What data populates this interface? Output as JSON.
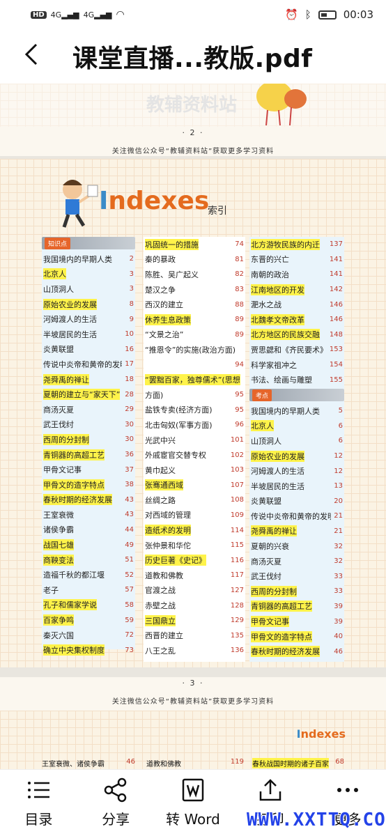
{
  "status": {
    "hd": "HD",
    "sim1": "4G",
    "sim2": "4G",
    "time": "00:03"
  },
  "header": {
    "back_icon": "chevron-left-icon",
    "title": "课堂直播...教版.pdf"
  },
  "page2": {
    "watermark": "教辅资料站",
    "page_number": "· 2 ·",
    "promo": "关注微信公众号“教辅资料站”获取更多学习资料"
  },
  "page3": {
    "index_title_I": "I",
    "index_title_rest": "ndexes",
    "index_subtitle": "索引",
    "col1": {
      "section": "知识点",
      "rows": [
        {
          "t": "我国境内的早期人类",
          "p": "2",
          "hl": false
        },
        {
          "t": "北京人",
          "p": "3",
          "hl": true
        },
        {
          "t": "山顶洞人",
          "p": "3",
          "hl": false
        },
        {
          "t": "原始农业的发展",
          "p": "8",
          "hl": true
        },
        {
          "t": "河姆渡人的生活",
          "p": "9",
          "hl": false
        },
        {
          "t": "半坡居民的生活",
          "p": "10",
          "hl": false
        },
        {
          "t": "炎黄联盟",
          "p": "16",
          "hl": false
        },
        {
          "t": "传说中炎帝和黄帝的发明",
          "p": "17",
          "hl": false
        },
        {
          "t": "尧舜禹的禅让",
          "p": "18",
          "hl": true
        },
        {
          "t": "夏朝的建立与“家天下”",
          "p": "28",
          "hl": true
        },
        {
          "t": "商汤灭夏",
          "p": "29",
          "hl": false
        },
        {
          "t": "武王伐纣",
          "p": "30",
          "hl": false
        },
        {
          "t": "西周的分封制",
          "p": "30",
          "hl": true
        },
        {
          "t": "青铜器的高超工艺",
          "p": "36",
          "hl": true
        },
        {
          "t": "甲骨文记事",
          "p": "37",
          "hl": false
        },
        {
          "t": "甲骨文的造字特点",
          "p": "38",
          "hl": true
        },
        {
          "t": "春秋时期的经济发展",
          "p": "43",
          "hl": true
        },
        {
          "t": "王室衰微",
          "p": "43",
          "hl": false
        },
        {
          "t": "诸侯争霸",
          "p": "44",
          "hl": false
        },
        {
          "t": "战国七雄",
          "p": "49",
          "hl": true
        },
        {
          "t": "商鞅变法",
          "p": "51",
          "hl": true
        },
        {
          "t": "造福千秋的都江堰",
          "p": "52",
          "hl": false
        },
        {
          "t": "老子",
          "p": "57",
          "hl": false
        },
        {
          "t": "孔子和儒家学说",
          "p": "58",
          "hl": true
        },
        {
          "t": "百家争鸣",
          "p": "59",
          "hl": true
        },
        {
          "t": "秦灭六国",
          "p": "72",
          "hl": false
        },
        {
          "t": "确立中央集权制度",
          "p": "73",
          "hl": true
        }
      ]
    },
    "col2": {
      "rows": [
        {
          "t": "巩固统一的措施",
          "p": "74",
          "hl": true
        },
        {
          "t": "秦的暴政",
          "p": "81",
          "hl": false
        },
        {
          "t": "陈胜、吴广起义",
          "p": "82",
          "hl": false
        },
        {
          "t": "楚汉之争",
          "p": "83",
          "hl": false
        },
        {
          "t": "西汉的建立",
          "p": "88",
          "hl": false
        },
        {
          "t": "休养生息政策",
          "p": "89",
          "hl": true
        },
        {
          "t": "“文景之治”",
          "p": "89",
          "hl": false
        },
        {
          "t": "“推恩令”的实施(政治方面)",
          "p": "",
          "hl": false
        },
        {
          "t": "",
          "p": "94",
          "hl": false
        },
        {
          "t": "“罢黜百家，独尊儒术”(思想",
          "p": "",
          "hl": true
        },
        {
          "t": "方面)",
          "p": "95",
          "hl": false
        },
        {
          "t": "盐铁专卖(经济方面)",
          "p": "95",
          "hl": false
        },
        {
          "t": "北击匈奴(军事方面)",
          "p": "96",
          "hl": false
        },
        {
          "t": "光武中兴",
          "p": "101",
          "hl": false
        },
        {
          "t": "外戚宦官交替专权",
          "p": "102",
          "hl": false
        },
        {
          "t": "黄巾起义",
          "p": "103",
          "hl": false
        },
        {
          "t": "张骞通西域",
          "p": "107",
          "hl": true
        },
        {
          "t": "丝绸之路",
          "p": "108",
          "hl": false
        },
        {
          "t": "对西域的管理",
          "p": "109",
          "hl": false
        },
        {
          "t": "造纸术的发明",
          "p": "114",
          "hl": true
        },
        {
          "t": "张仲景和华佗",
          "p": "115",
          "hl": false
        },
        {
          "t": "历史巨著《史记》",
          "p": "116",
          "hl": true
        },
        {
          "t": "道教和佛教",
          "p": "117",
          "hl": false
        },
        {
          "t": "官渡之战",
          "p": "127",
          "hl": false
        },
        {
          "t": "赤壁之战",
          "p": "128",
          "hl": false
        },
        {
          "t": "三国鼎立",
          "p": "129",
          "hl": true
        },
        {
          "t": "西晋的建立",
          "p": "135",
          "hl": false
        },
        {
          "t": "八王之乱",
          "p": "136",
          "hl": false
        }
      ]
    },
    "col3": {
      "rows_top": [
        {
          "t": "北方游牧民族的内迁",
          "p": "137",
          "hl": true
        },
        {
          "t": "东晋的兴亡",
          "p": "141",
          "hl": false
        },
        {
          "t": "南朝的政治",
          "p": "141",
          "hl": false
        },
        {
          "t": "江南地区的开发",
          "p": "142",
          "hl": true
        },
        {
          "t": "淝水之战",
          "p": "146",
          "hl": false
        },
        {
          "t": "北魏孝文帝改革",
          "p": "146",
          "hl": true
        },
        {
          "t": "北方地区的民族交融",
          "p": "148",
          "hl": true
        },
        {
          "t": "贾思勰和《齐民要术》",
          "p": "153",
          "hl": false
        },
        {
          "t": "科学家祖冲之",
          "p": "154",
          "hl": false
        },
        {
          "t": "书法、绘画与雕塑",
          "p": "155",
          "hl": false
        }
      ],
      "section": "考点",
      "rows_bottom": [
        {
          "t": "我国境内的早期人类",
          "p": "5",
          "hl": false
        },
        {
          "t": "北京人",
          "p": "6",
          "hl": true
        },
        {
          "t": "山顶洞人",
          "p": "6",
          "hl": false
        },
        {
          "t": "原始农业的发展",
          "p": "12",
          "hl": true
        },
        {
          "t": "河姆渡人的生活",
          "p": "12",
          "hl": false
        },
        {
          "t": "半坡居民的生活",
          "p": "13",
          "hl": false
        },
        {
          "t": "炎黄联盟",
          "p": "20",
          "hl": false
        },
        {
          "t": "传说中炎帝和黄帝的发明",
          "p": "21",
          "hl": false
        },
        {
          "t": "尧舜禹的禅让",
          "p": "21",
          "hl": true
        },
        {
          "t": "夏朝的兴衰",
          "p": "32",
          "hl": false
        },
        {
          "t": "商汤灭夏",
          "p": "32",
          "hl": false
        },
        {
          "t": "武王伐纣",
          "p": "33",
          "hl": false
        },
        {
          "t": "西周的分封制",
          "p": "33",
          "hl": true
        },
        {
          "t": "青铜器的高超工艺",
          "p": "39",
          "hl": true
        },
        {
          "t": "甲骨文记事",
          "p": "39",
          "hl": true
        },
        {
          "t": "甲骨文的造字特点",
          "p": "40",
          "hl": true
        },
        {
          "t": "春秋时期的经济发展",
          "p": "46",
          "hl": true
        }
      ]
    },
    "page_number": "· 3 ·",
    "promo": "关注微信公众号“教辅资料站”获取更多学习资料"
  },
  "page4_peek": {
    "index_title_I": "I",
    "index_title_rest": "ndexes",
    "c1": {
      "t": "王室衰微、诸侯争霸",
      "p": "46"
    },
    "c2": {
      "t": "道教和佛教",
      "p": "119"
    },
    "c3": {
      "t": "春秋战国时期的诸子百家",
      "p": "68"
    }
  },
  "toolbar": {
    "items": [
      {
        "label": "目录",
        "icon": "list-icon"
      },
      {
        "label": "分享",
        "icon": "share-icon"
      },
      {
        "label": "转 Word",
        "icon": "convert-word-icon"
      },
      {
        "label": "打印",
        "icon": "upload-icon"
      },
      {
        "label": "更多",
        "icon": "more-icon"
      }
    ]
  },
  "watermark_banner": "WWW.XXTTQ.COM",
  "colors": {
    "highlight": "#fff34a",
    "accent_orange": "#e46b1e",
    "accent_blue": "#3a8bc8",
    "page_num_red": "#c03a2b"
  }
}
